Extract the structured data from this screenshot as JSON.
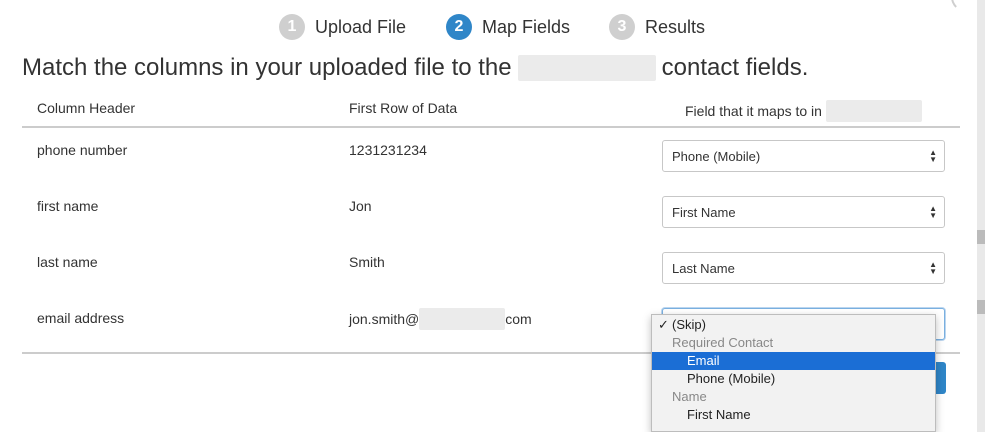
{
  "steps": [
    {
      "number": "1",
      "label": "Upload File",
      "state": "inactive"
    },
    {
      "number": "2",
      "label": "Map Fields",
      "state": "active"
    },
    {
      "number": "3",
      "label": "Results",
      "state": "inactive"
    }
  ],
  "heading": {
    "prefix": "Match the columns in your uploaded file to the",
    "suffix": "contact fields."
  },
  "table": {
    "headers": {
      "column": "Column Header",
      "first_row": "First Row of Data",
      "field": "Field that it maps to in"
    },
    "rows": [
      {
        "column": "phone number",
        "first_row": "1231231234",
        "mapping": "Phone (Mobile)"
      },
      {
        "column": "first name",
        "first_row": "Jon",
        "mapping": "First Name"
      },
      {
        "column": "last name",
        "first_row": "Smith",
        "mapping": "Last Name"
      },
      {
        "column": "email address",
        "first_row_prefix": "jon.smith@",
        "first_row_suffix": "com",
        "mapping": ""
      }
    ]
  },
  "dropdown": {
    "options": [
      {
        "label": "(Skip)",
        "checked": true
      },
      {
        "group": "Required Contact"
      },
      {
        "label": "Email",
        "highlighted": true
      },
      {
        "label": "Phone (Mobile)"
      },
      {
        "group": "Name"
      },
      {
        "label": "First Name"
      }
    ]
  },
  "icons": {
    "checkmark": "✓",
    "select_arrows": "select-arrows-icon"
  },
  "colors": {
    "accent": "#2f86c8",
    "step_inactive": "#cfcfcf",
    "highlight": "#1b6ed5"
  }
}
